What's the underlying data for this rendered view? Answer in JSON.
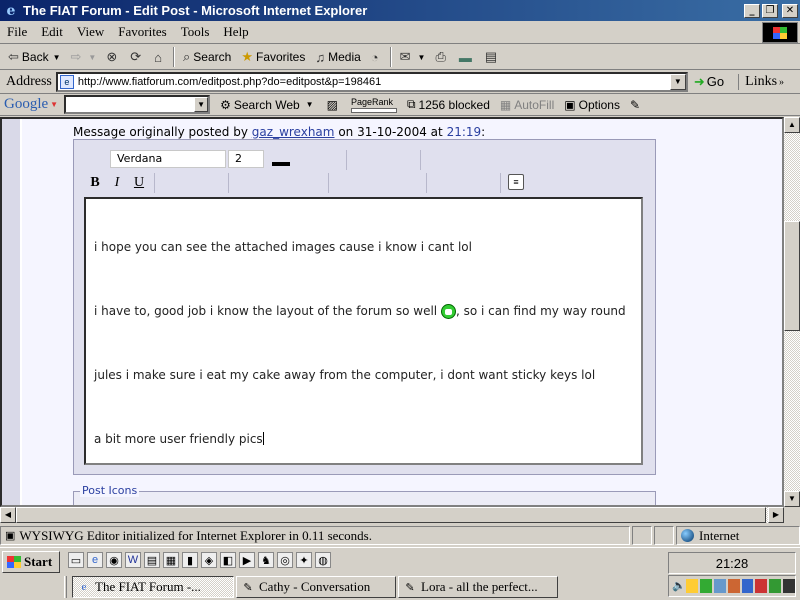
{
  "window": {
    "title": "The FIAT Forum - Edit Post - Microsoft Internet Explorer",
    "minimize": "_",
    "maximize": "❐",
    "close": "✕"
  },
  "menubar": {
    "items": [
      "File",
      "Edit",
      "View",
      "Favorites",
      "Tools",
      "Help"
    ]
  },
  "toolbar": {
    "back": "Back",
    "search": "Search",
    "favorites": "Favorites",
    "media": "Media"
  },
  "addressbar": {
    "label": "Address",
    "url": "http://www.fiatforum.com/editpost.php?do=editpost&p=198461",
    "go": "Go",
    "links": "Links"
  },
  "googlebar": {
    "logo": "Google",
    "search_value": "",
    "search_web": "Search Web",
    "pagerank": "PageRank",
    "blocked": "1256 blocked",
    "autofill": "AutoFill",
    "options": "Options"
  },
  "post": {
    "prefix": "Message originally posted by",
    "author": "gaz_wrexham",
    "on": "on",
    "date": "31-10-2004",
    "at": "at",
    "time": "21:19",
    "colon": ":"
  },
  "editor": {
    "font": "Verdana",
    "size": "2",
    "bold": "B",
    "italic": "I",
    "underline": "U",
    "paragraphs": [
      "i hope you can see the attached images cause i know i cant lol",
      "i have to, good job i know the layout of the forum so well",
      ", so i can find my way round",
      "jules i make sure i eat my cake away from the computer, i dont want sticky keys lol",
      "a bit more user friendly pics"
    ]
  },
  "post_icons": {
    "legend": "Post Icons"
  },
  "statusbar": {
    "message": "WYSIWYG Editor initialized for Internet Explorer in 0.11 seconds.",
    "zone": "Internet"
  },
  "taskbar": {
    "start": "Start",
    "clock": "21:28",
    "tasks": [
      {
        "label": "The FIAT Forum -...",
        "active": true
      },
      {
        "label": "Cathy - Conversation",
        "active": false
      },
      {
        "label": "Lora - all the perfect...",
        "active": false
      }
    ]
  },
  "colors": {
    "titlebar_start": "#0a246a",
    "titlebar_end": "#3a6ea5",
    "link": "#2a3fa0",
    "page_bg": "#f5f5ff"
  }
}
